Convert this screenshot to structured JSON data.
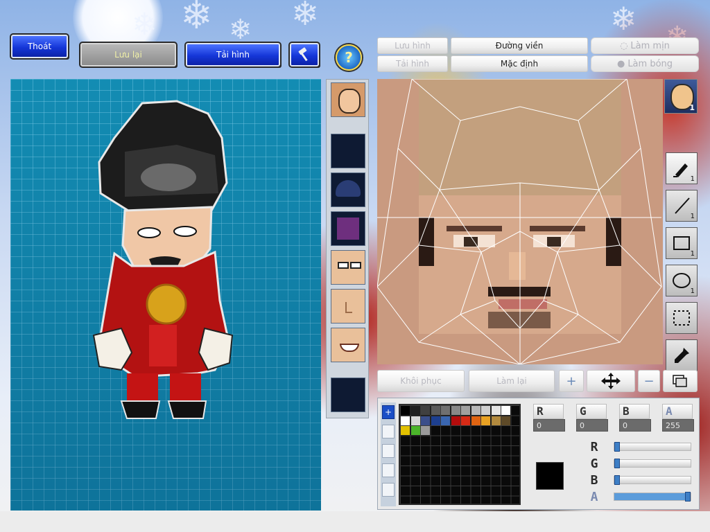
{
  "toolbar": {
    "exit_label": "Thoát",
    "save_label": "Lưu lại",
    "reload_label": "Tải hình",
    "hammer_icon": "hammer-icon"
  },
  "help": {
    "icon": "question-icon",
    "label": "?"
  },
  "face_tabs": {
    "save_image": "Lưu hình",
    "load_image": "Tải hình",
    "outline": "Đường viền",
    "default": "Mặc định",
    "smooth": "Làm mịn",
    "shade": "Làm bóng"
  },
  "parts": [
    "face-preview",
    "empty-slot",
    "helmet",
    "armor",
    "eyes",
    "nose",
    "mouth",
    "empty-slot"
  ],
  "avatar_badge": "1",
  "tools": [
    {
      "name": "pen-tool",
      "count": "1"
    },
    {
      "name": "line-tool",
      "count": "1"
    },
    {
      "name": "rect-tool",
      "count": "1"
    },
    {
      "name": "ellipse-tool",
      "count": "1"
    },
    {
      "name": "select-tool",
      "count": ""
    },
    {
      "name": "eyedropper-tool",
      "count": ""
    }
  ],
  "edit_bar": {
    "restore": "Khôi phục",
    "redo": "Làm lại",
    "zoom_in": "+",
    "move": "move-icon",
    "zoom_out": "−",
    "layers": "layers-icon"
  },
  "palette": {
    "tab_active": "+",
    "swatches_row1": [
      "#000000",
      "#202020",
      "#404040",
      "#5a5a5a",
      "#707070",
      "#888888",
      "#a0a0a0",
      "#b8b8b8",
      "#cfcfcf",
      "#e5e5e5",
      "#ffffff"
    ],
    "swatches_row2": [
      "#ffffff",
      "#d8d8d8",
      "#3a4e8a",
      "#1d3f8f",
      "#3a66b0",
      "#b30c0c",
      "#d62a16",
      "#e06412",
      "#e9a223",
      "#b28a3e",
      "#5e4a28"
    ],
    "swatches_row3": [
      "#e2c100",
      "#4bb52a",
      "#9a9a9a"
    ],
    "current_color": "#000000"
  },
  "channels": {
    "r_label": "R",
    "g_label": "G",
    "b_label": "B",
    "a_label": "A",
    "r_value": "0",
    "g_value": "0",
    "b_value": "0",
    "a_value": "255",
    "r_level": 0,
    "g_level": 0,
    "b_level": 0,
    "a_level": 1.0
  }
}
